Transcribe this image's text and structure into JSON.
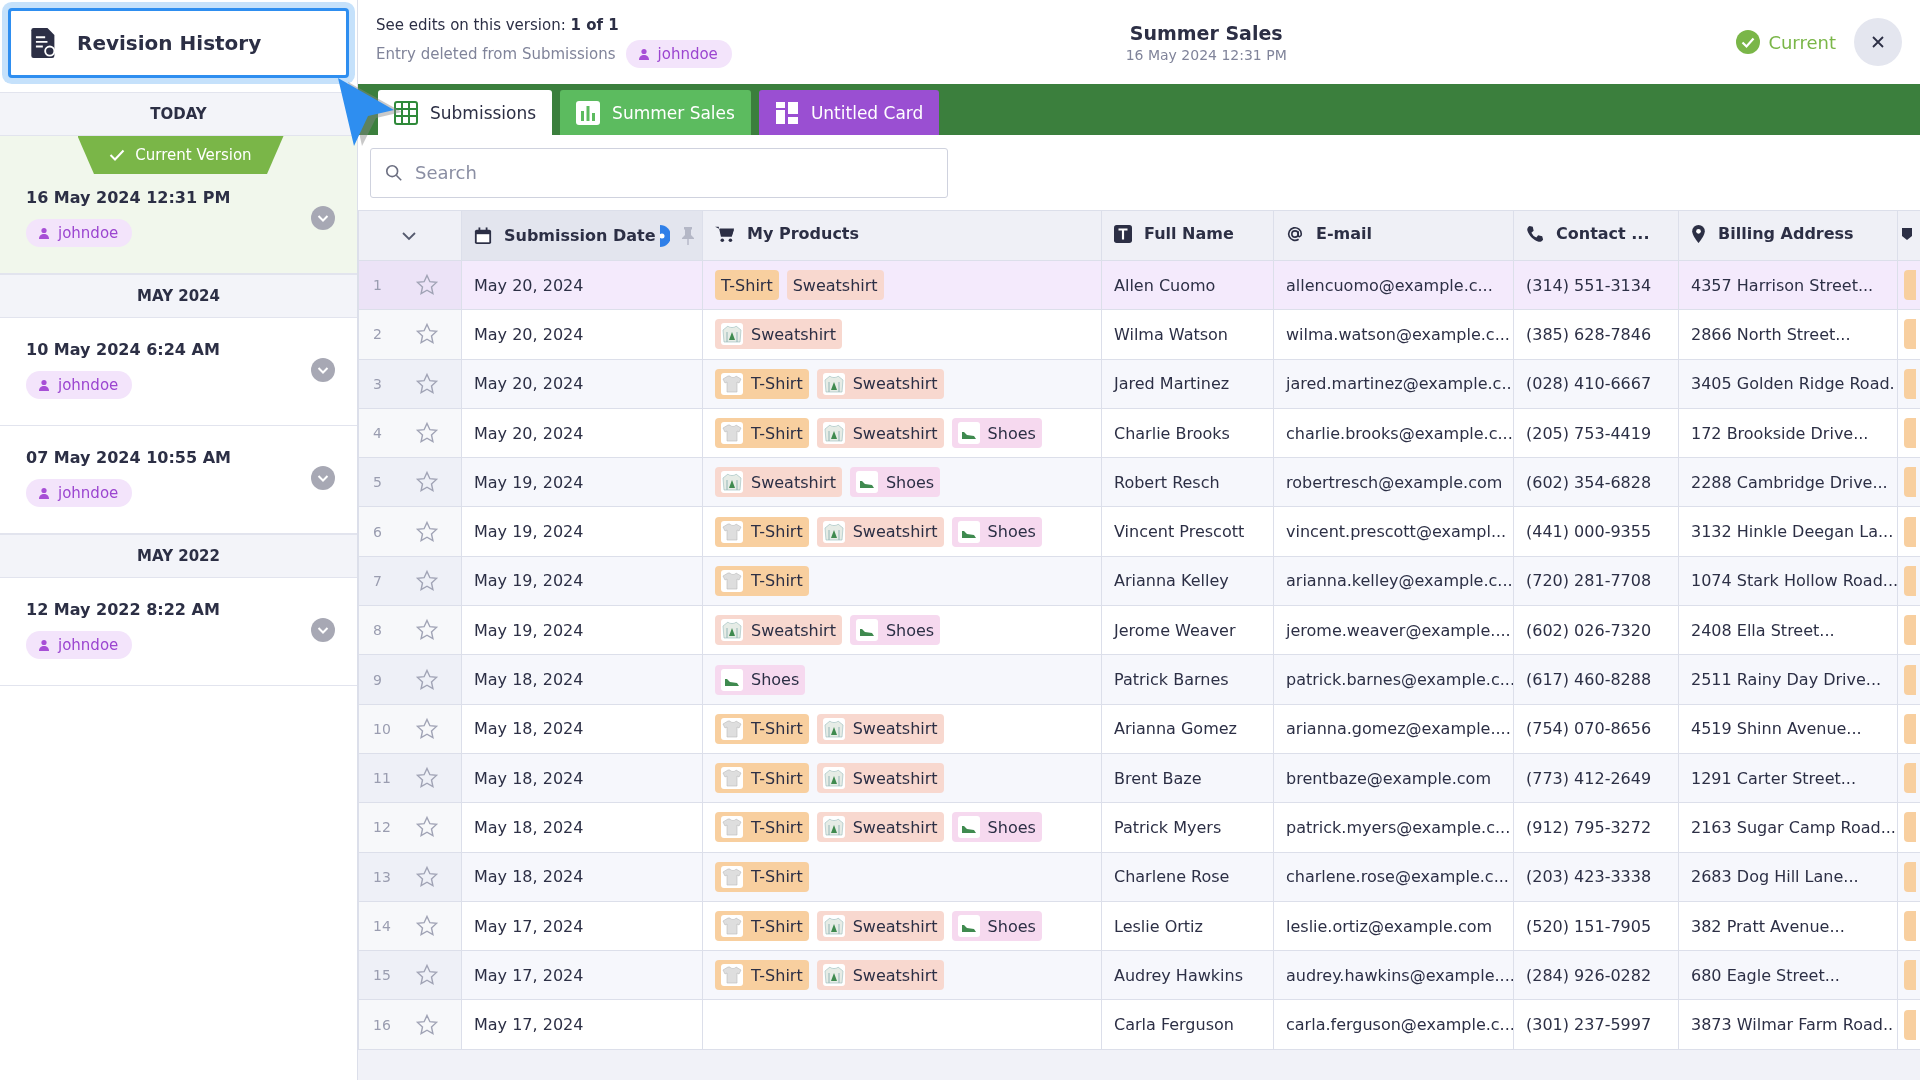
{
  "sidebar": {
    "title": "Revision History",
    "groups": [
      {
        "heading": "TODAY",
        "entries": [
          {
            "badge": "Current Version",
            "time": "16 May 2024 12:31 PM",
            "user": "johndoe",
            "selected": true
          }
        ]
      },
      {
        "heading": "MAY 2024",
        "entries": [
          {
            "time": "10 May 2024 6:24 AM",
            "user": "johndoe",
            "selected": false
          },
          {
            "time": "07 May 2024 10:55 AM",
            "user": "johndoe",
            "selected": false
          }
        ]
      },
      {
        "heading": "MAY 2022",
        "entries": [
          {
            "time": "12 May 2022 8:22 AM",
            "user": "johndoe",
            "selected": false
          }
        ]
      }
    ]
  },
  "header": {
    "edits_line": "See edits on this version:  **1 of 1**",
    "change": "Entry deleted from Submissions",
    "user": "johndoe",
    "title": "Summer Sales",
    "date": "16 May 2024 12:31 PM",
    "status": "Current"
  },
  "tabs": [
    {
      "label": "Submissions",
      "kind": "table",
      "color": "#ffffff",
      "selected": true
    },
    {
      "label": "Summer Sales",
      "kind": "report",
      "color": "#5cbb5f",
      "selected": false
    },
    {
      "label": "Untitled Card",
      "kind": "card",
      "color": "#9a4fd2",
      "selected": false
    }
  ],
  "search": {
    "placeholder": "Search"
  },
  "table": {
    "columns": [
      {
        "label": "Submission Date",
        "kind": "date"
      },
      {
        "label": "My Products",
        "kind": "products"
      },
      {
        "label": "Full Name",
        "kind": "text"
      },
      {
        "label": "E-mail",
        "kind": "email"
      },
      {
        "label": "Contact ...",
        "kind": "phone"
      },
      {
        "label": "Billing Address",
        "kind": "address"
      }
    ],
    "rows": [
      {
        "number": "1",
        "starred": false,
        "selected": true,
        "date": "May 20, 2024",
        "products": [
          {
            "label": "T-Shirt",
            "kind": "tshirt",
            "thumbnail": false
          },
          {
            "label": "Sweatshirt",
            "kind": "sweatshirt",
            "thumbnail": false
          }
        ],
        "name": "Allen Cuomo",
        "email": "allencuomo@example.c...",
        "phone": "(314) 551-3134",
        "address": "4357 Harrison Street..."
      },
      {
        "number": "2",
        "starred": false,
        "selected": false,
        "date": "May 20, 2024",
        "products": [
          {
            "label": "Sweatshirt",
            "kind": "sweatshirt",
            "thumbnail": true
          }
        ],
        "name": "Wilma Watson",
        "email": "wilma.watson@example.c...",
        "phone": "(385) 628-7846",
        "address": "2866 North Street..."
      },
      {
        "number": "3",
        "starred": false,
        "selected": false,
        "date": "May 20, 2024",
        "products": [
          {
            "label": "T-Shirt",
            "kind": "tshirt",
            "thumbnail": true
          },
          {
            "label": "Sweatshirt",
            "kind": "sweatshirt",
            "thumbnail": true
          }
        ],
        "name": "Jared Martinez",
        "email": "jared.martinez@example.c...",
        "phone": "(028) 410-6667",
        "address": "3405 Golden Ridge Road."
      },
      {
        "number": "4",
        "starred": false,
        "selected": false,
        "date": "May 20, 2024",
        "products": [
          {
            "label": "T-Shirt",
            "kind": "tshirt",
            "thumbnail": true
          },
          {
            "label": "Sweatshirt",
            "kind": "sweatshirt",
            "thumbnail": true
          },
          {
            "label": "Shoes",
            "kind": "shoes",
            "thumbnail": true
          }
        ],
        "name": "Charlie Brooks",
        "email": "charlie.brooks@example.c...",
        "phone": "(205) 753-4419",
        "address": "172 Brookside Drive..."
      },
      {
        "number": "5",
        "starred": false,
        "selected": false,
        "date": "May 19, 2024",
        "products": [
          {
            "label": "Sweatshirt",
            "kind": "sweatshirt",
            "thumbnail": true
          },
          {
            "label": "Shoes",
            "kind": "shoes",
            "thumbnail": true
          }
        ],
        "name": "Robert Resch",
        "email": "robertresch@example.com",
        "phone": "(602) 354-6828",
        "address": "2288 Cambridge Drive..."
      },
      {
        "number": "6",
        "starred": false,
        "selected": false,
        "date": "May 19, 2024",
        "products": [
          {
            "label": "T-Shirt",
            "kind": "tshirt",
            "thumbnail": true
          },
          {
            "label": "Sweatshirt",
            "kind": "sweatshirt",
            "thumbnail": true
          },
          {
            "label": "Shoes",
            "kind": "shoes",
            "thumbnail": true
          }
        ],
        "name": "Vincent Prescott",
        "email": "vincent.prescott@exampl...",
        "phone": "(441) 000-9355",
        "address": "3132 Hinkle Deegan La..."
      },
      {
        "number": "7",
        "starred": false,
        "selected": false,
        "date": "May 19, 2024",
        "products": [
          {
            "label": "T-Shirt",
            "kind": "tshirt",
            "thumbnail": true
          }
        ],
        "name": "Arianna Kelley",
        "email": "arianna.kelley@example.c...",
        "phone": "(720) 281-7708",
        "address": "1074 Stark Hollow Road..."
      },
      {
        "number": "8",
        "starred": false,
        "selected": false,
        "date": "May 19, 2024",
        "products": [
          {
            "label": "Sweatshirt",
            "kind": "sweatshirt",
            "thumbnail": true
          },
          {
            "label": "Shoes",
            "kind": "shoes",
            "thumbnail": true
          }
        ],
        "name": "Jerome Weaver",
        "email": "jerome.weaver@example....",
        "phone": "(602) 026-7320",
        "address": "2408 Ella Street..."
      },
      {
        "number": "9",
        "starred": false,
        "selected": false,
        "date": "May 18, 2024",
        "products": [
          {
            "label": "Shoes",
            "kind": "shoes",
            "thumbnail": true
          }
        ],
        "name": "Patrick Barnes",
        "email": "patrick.barnes@example.c...",
        "phone": "(617) 460-8288",
        "address": "2511 Rainy Day Drive..."
      },
      {
        "number": "10",
        "starred": false,
        "selected": false,
        "date": "May 18, 2024",
        "products": [
          {
            "label": "T-Shirt",
            "kind": "tshirt",
            "thumbnail": true
          },
          {
            "label": "Sweatshirt",
            "kind": "sweatshirt",
            "thumbnail": true
          }
        ],
        "name": "Arianna Gomez",
        "email": "arianna.gomez@example....",
        "phone": "(754) 070-8656",
        "address": "4519 Shinn Avenue..."
      },
      {
        "number": "11",
        "starred": false,
        "selected": false,
        "date": "May 18, 2024",
        "products": [
          {
            "label": "T-Shirt",
            "kind": "tshirt",
            "thumbnail": true
          },
          {
            "label": "Sweatshirt",
            "kind": "sweatshirt",
            "thumbnail": true
          }
        ],
        "name": "Brent Baze",
        "email": "brentbaze@example.com",
        "phone": "(773) 412-2649",
        "address": "1291 Carter Street..."
      },
      {
        "number": "12",
        "starred": false,
        "selected": false,
        "date": "May 18, 2024",
        "products": [
          {
            "label": "T-Shirt",
            "kind": "tshirt",
            "thumbnail": true
          },
          {
            "label": "Sweatshirt",
            "kind": "sweatshirt",
            "thumbnail": true
          },
          {
            "label": "Shoes",
            "kind": "shoes",
            "thumbnail": true
          }
        ],
        "name": "Patrick Myers",
        "email": "patrick.myers@example.c...",
        "phone": "(912) 795-3272",
        "address": "2163 Sugar Camp Road..."
      },
      {
        "number": "13",
        "starred": false,
        "selected": false,
        "date": "May 18, 2024",
        "products": [
          {
            "label": "T-Shirt",
            "kind": "tshirt",
            "thumbnail": true
          }
        ],
        "name": "Charlene Rose",
        "email": "charlene.rose@example.c...",
        "phone": "(203) 423-3338",
        "address": "2683 Dog Hill Lane..."
      },
      {
        "number": "14",
        "starred": false,
        "selected": false,
        "date": "May 17, 2024",
        "products": [
          {
            "label": "T-Shirt",
            "kind": "tshirt",
            "thumbnail": true
          },
          {
            "label": "Sweatshirt",
            "kind": "sweatshirt",
            "thumbnail": true
          },
          {
            "label": "Shoes",
            "kind": "shoes",
            "thumbnail": true
          }
        ],
        "name": "Leslie Ortiz",
        "email": "leslie.ortiz@example.com",
        "phone": "(520) 151-7905",
        "address": "382 Pratt Avenue..."
      },
      {
        "number": "15",
        "starred": false,
        "selected": false,
        "date": "May 17, 2024",
        "products": [
          {
            "label": "T-Shirt",
            "kind": "tshirt",
            "thumbnail": true
          },
          {
            "label": "Sweatshirt",
            "kind": "sweatshirt",
            "thumbnail": true
          }
        ],
        "name": "Audrey Hawkins",
        "email": "audrey.hawkins@example....",
        "phone": "(284) 926-0282",
        "address": "680 Eagle Street..."
      },
      {
        "number": "16",
        "starred": false,
        "selected": false,
        "date": "May 17, 2024",
        "name": "Carla Ferguson",
        "email": "carla.ferguson@example.c...",
        "phone": "(301) 237-5997",
        "address": "3873 Wilmar Farm Road.."
      }
    ]
  }
}
